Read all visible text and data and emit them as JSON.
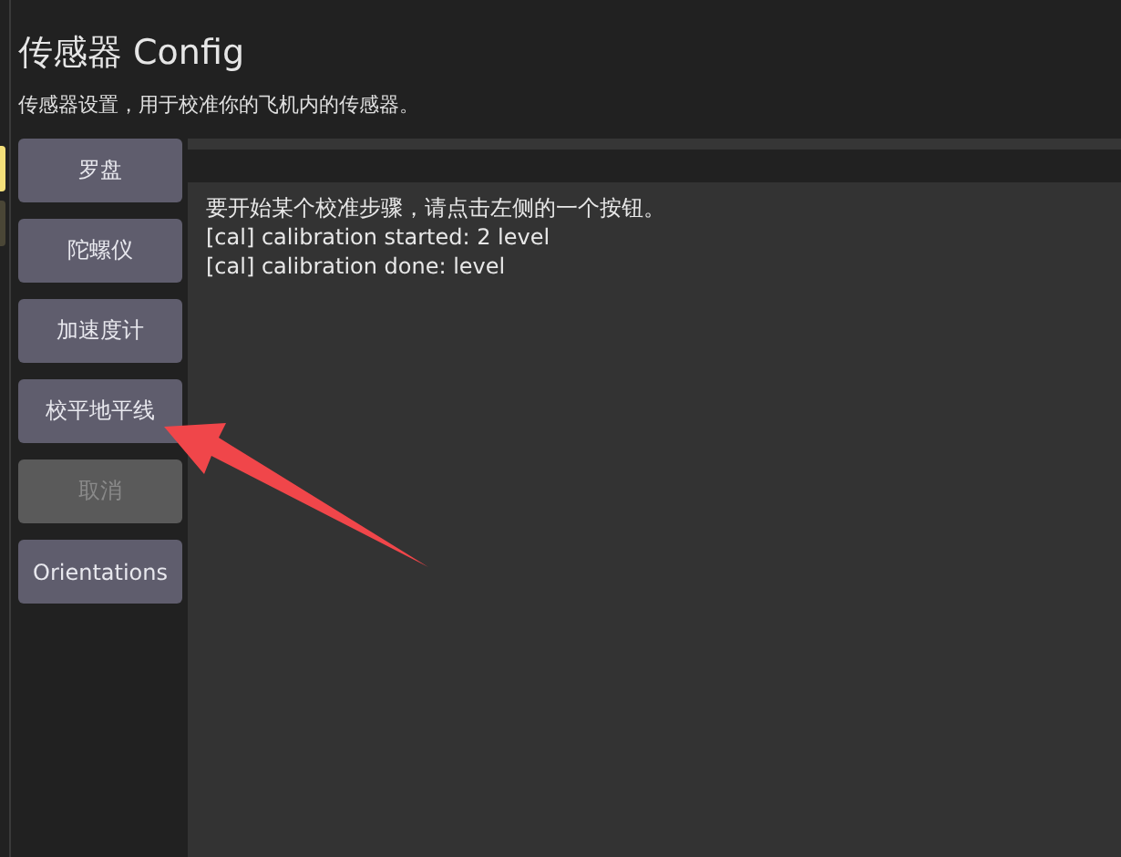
{
  "header": {
    "title": "传感器 Config",
    "description": "传感器设置，用于校准你的飞机内的传感器。"
  },
  "buttons": [
    {
      "label": "罗盘",
      "disabled": false
    },
    {
      "label": "陀螺仪",
      "disabled": false
    },
    {
      "label": "加速度计",
      "disabled": false
    },
    {
      "label": "校平地平线",
      "disabled": false
    },
    {
      "label": "取消",
      "disabled": true
    },
    {
      "label": "Orientations",
      "disabled": false
    }
  ],
  "progress": {
    "level": 0
  },
  "log": [
    "要开始某个校准步骤，请点击左侧的一个按钮。",
    "[cal] calibration started: 2 level",
    "[cal] calibration done: level"
  ]
}
